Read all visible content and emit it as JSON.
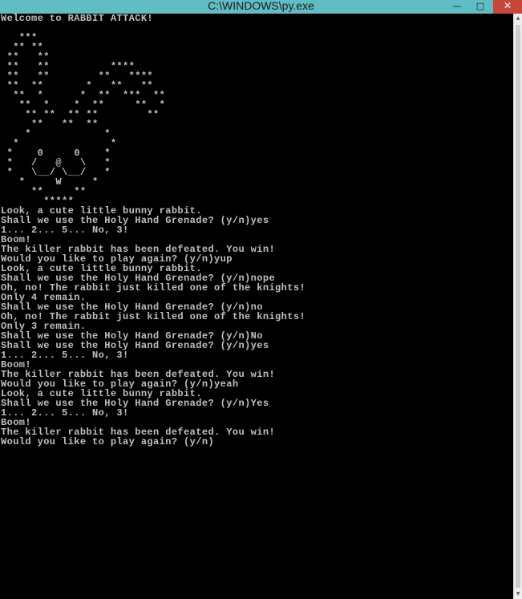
{
  "window": {
    "title": "C:\\WINDOWS\\py.exe",
    "minimize_glyph": "—",
    "maximize_glyph": "□",
    "close_glyph": "✕"
  },
  "console": {
    "lines": [
      "Welcome to RABBIT ATTACK!",
      "",
      "   ***",
      "  ** **",
      " **   **",
      " **   **          ****",
      " **   **        **   ****",
      " **  **       *   **   **",
      "  **  *      *  **  ***  **",
      "   **  *    *  **     **  *",
      "    ** **  ** **        **",
      "     **   **  **",
      "    *            *",
      "  *               *",
      " *    0     0    *",
      " *   /   @   \\   *",
      " *   \\__/ \\__/   *",
      "   *     W     *",
      "     **     **",
      "       *****",
      "Look, a cute little bunny rabbit.",
      "Shall we use the Holy Hand Grenade? (y/n)yes",
      "1... 2... 5... No, 3!",
      "Boom!",
      "The killer rabbit has been defeated. You win!",
      "Would you like to play again? (y/n)yup",
      "Look, a cute little bunny rabbit.",
      "Shall we use the Holy Hand Grenade? (y/n)nope",
      "Oh, no! The rabbit just killed one of the knights!",
      "Only 4 remain.",
      "Shall we use the Holy Hand Grenade? (y/n)no",
      "Oh, no! The rabbit just killed one of the knights!",
      "Only 3 remain.",
      "Shall we use the Holy Hand Grenade? (y/n)No",
      "Shall we use the Holy Hand Grenade? (y/n)yes",
      "1... 2... 5... No, 3!",
      "Boom!",
      "The killer rabbit has been defeated. You win!",
      "Would you like to play again? (y/n)yeah",
      "Look, a cute little bunny rabbit.",
      "Shall we use the Holy Hand Grenade? (y/n)Yes",
      "1... 2... 5... No, 3!",
      "Boom!",
      "The killer rabbit has been defeated. You win!",
      "Would you like to play again? (y/n)"
    ]
  },
  "colors": {
    "titlebar": "#5fbdc3",
    "close_button": "#c9463d",
    "console_background": "#000000",
    "console_text": "#c0c0c0",
    "scrollbar_track": "#eeeeee",
    "scrollbar_thumb": "#cdcdcd"
  },
  "icons": {
    "minimize": "minimize-icon",
    "maximize": "maximize-icon",
    "close": "close-icon",
    "scroll_up": "scroll-up-arrow-icon",
    "scroll_down": "scroll-down-arrow-icon"
  }
}
